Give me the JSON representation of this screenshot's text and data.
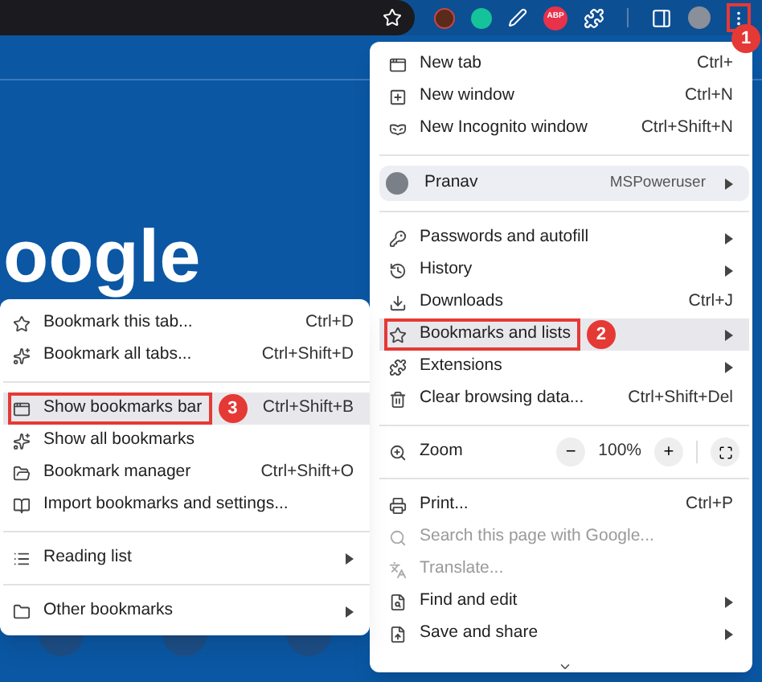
{
  "page": {
    "logo_fragment": "oogle"
  },
  "toolbar": {
    "extension_label": "ABP"
  },
  "main_menu": {
    "sections": [
      [
        {
          "kind": "item",
          "label": "New tab",
          "shortcut": "Ctrl+",
          "submenu": false,
          "disabled": false,
          "selected": false
        },
        {
          "kind": "item",
          "label": "New window",
          "shortcut": "Ctrl+N",
          "submenu": false,
          "disabled": false,
          "selected": false
        },
        {
          "kind": "item",
          "label": "New Incognito window",
          "shortcut": "Ctrl+Shift+N",
          "submenu": false,
          "disabled": false,
          "selected": false
        }
      ],
      [
        {
          "kind": "profile",
          "label": "Pranav",
          "badge": "MSPoweruser",
          "submenu": true,
          "disabled": false,
          "selected": false
        }
      ],
      [
        {
          "kind": "item",
          "label": "Passwords and autofill",
          "submenu": true,
          "disabled": false,
          "selected": false
        },
        {
          "kind": "item",
          "label": "History",
          "submenu": true,
          "disabled": false,
          "selected": false
        },
        {
          "kind": "item",
          "label": "Downloads",
          "shortcut": "Ctrl+J",
          "submenu": false,
          "disabled": false,
          "selected": false
        },
        {
          "kind": "item",
          "label": "Bookmarks and lists",
          "submenu": true,
          "disabled": false,
          "selected": true,
          "callout": "2"
        },
        {
          "kind": "item",
          "label": "Extensions",
          "submenu": true,
          "disabled": false,
          "selected": false
        },
        {
          "kind": "item",
          "label": "Clear browsing data...",
          "shortcut": "Ctrl+Shift+Del",
          "submenu": false,
          "disabled": false,
          "selected": false
        }
      ],
      [
        {
          "kind": "zoom",
          "label": "Zoom",
          "minus": "−",
          "value": "100%",
          "plus": "+"
        }
      ],
      [
        {
          "kind": "item",
          "label": "Print...",
          "shortcut": "Ctrl+P",
          "submenu": false,
          "disabled": false,
          "selected": false
        },
        {
          "kind": "item",
          "label": "Search this page with Google...",
          "submenu": false,
          "disabled": true,
          "selected": false
        },
        {
          "kind": "item",
          "label": "Translate...",
          "submenu": false,
          "disabled": true,
          "selected": false
        },
        {
          "kind": "item",
          "label": "Find and edit",
          "submenu": true,
          "disabled": false,
          "selected": false
        },
        {
          "kind": "item",
          "label": "Save and share",
          "submenu": true,
          "disabled": false,
          "selected": false
        }
      ]
    ]
  },
  "bookmarks_menu": {
    "sections": [
      [
        {
          "label": "Bookmark this tab...",
          "shortcut": "Ctrl+D",
          "submenu": false,
          "selected": false
        },
        {
          "label": "Bookmark all tabs...",
          "shortcut": "Ctrl+Shift+D",
          "submenu": false,
          "selected": false
        }
      ],
      [
        {
          "label": "Show bookmarks bar",
          "shortcut": "Ctrl+Shift+B",
          "submenu": false,
          "selected": true,
          "callout": "3"
        },
        {
          "label": "Show all bookmarks",
          "submenu": false,
          "selected": false
        },
        {
          "label": "Bookmark manager",
          "shortcut": "Ctrl+Shift+O",
          "submenu": false,
          "selected": false
        },
        {
          "label": "Import bookmarks and settings...",
          "submenu": false,
          "selected": false
        }
      ],
      [
        {
          "label": "Reading list",
          "submenu": true,
          "selected": false
        }
      ],
      [
        {
          "label": "Other bookmarks",
          "submenu": true,
          "selected": false
        }
      ]
    ]
  },
  "menu_button_callout": "1"
}
